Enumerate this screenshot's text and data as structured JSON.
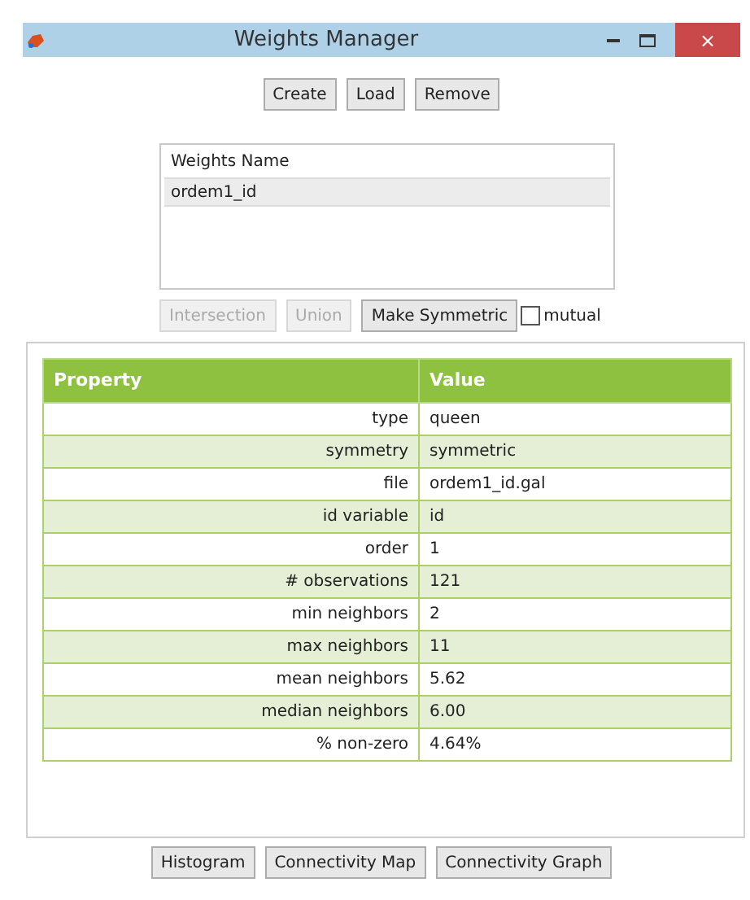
{
  "window": {
    "title": "Weights Manager",
    "close": "×"
  },
  "top_buttons": [
    "Create",
    "Load",
    "Remove"
  ],
  "weights_list": {
    "header": "Weights Name",
    "items": [
      {
        "label": "ordem1_id",
        "selected": true
      }
    ]
  },
  "ops_buttons": [
    {
      "label": "Intersection",
      "disabled": true
    },
    {
      "label": "Union",
      "disabled": true
    },
    {
      "label": "Make Symmetric",
      "disabled": false
    }
  ],
  "mutual": {
    "label": "mutual",
    "checked": false
  },
  "table": {
    "columns": [
      "Property",
      "Value"
    ],
    "rows": [
      [
        "type",
        "queen"
      ],
      [
        "symmetry",
        "symmetric"
      ],
      [
        "file",
        "ordem1_id.gal"
      ],
      [
        "id variable",
        "id"
      ],
      [
        "order",
        "1"
      ],
      [
        "# observations",
        "121"
      ],
      [
        "min neighbors",
        "2"
      ],
      [
        "max neighbors",
        "11"
      ],
      [
        "mean neighbors",
        "5.62"
      ],
      [
        "median neighbors",
        "6.00"
      ],
      [
        "% non-zero",
        "4.64%"
      ]
    ]
  },
  "bottom_buttons": [
    "Histogram",
    "Connectivity Map",
    "Connectivity Graph"
  ]
}
